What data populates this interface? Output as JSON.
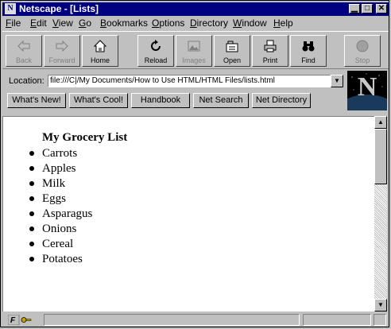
{
  "window": {
    "title": "Netscape - [Lists]",
    "app_icon": "N",
    "controls": [
      "minimize-icon",
      "maximize-icon",
      "close-icon"
    ]
  },
  "menu": {
    "items": [
      {
        "label": "File",
        "key": "F"
      },
      {
        "label": "Edit",
        "key": "E"
      },
      {
        "label": "View",
        "key": "V"
      },
      {
        "label": "Go",
        "key": "G"
      },
      {
        "label": "Bookmarks",
        "key": "B"
      },
      {
        "label": "Options",
        "key": "O"
      },
      {
        "label": "Directory",
        "key": "D"
      },
      {
        "label": "Window",
        "key": "W"
      },
      {
        "label": "Help",
        "key": "H"
      }
    ]
  },
  "toolbar": {
    "back": "Back",
    "forward": "Forward",
    "home": "Home",
    "reload": "Reload",
    "images": "Images",
    "open": "Open",
    "print": "Print",
    "find": "Find",
    "stop": "Stop"
  },
  "location": {
    "label": "Location:",
    "value": "file:///C|/My Documents/How to Use HTML/HTML Files/lists.html"
  },
  "directory_buttons": [
    "What's New!",
    "What's Cool!",
    "Handbook",
    "Net Search",
    "Net Directory"
  ],
  "page": {
    "heading": "My Grocery List",
    "items": [
      "Carrots",
      "Apples",
      "Milk",
      "Eggs",
      "Asparagus",
      "Onions",
      "Cereal",
      "Potatoes"
    ]
  },
  "colors": {
    "titlebar": "#000080",
    "chrome": "#c0c0c0",
    "content_bg": "#ffffff"
  }
}
